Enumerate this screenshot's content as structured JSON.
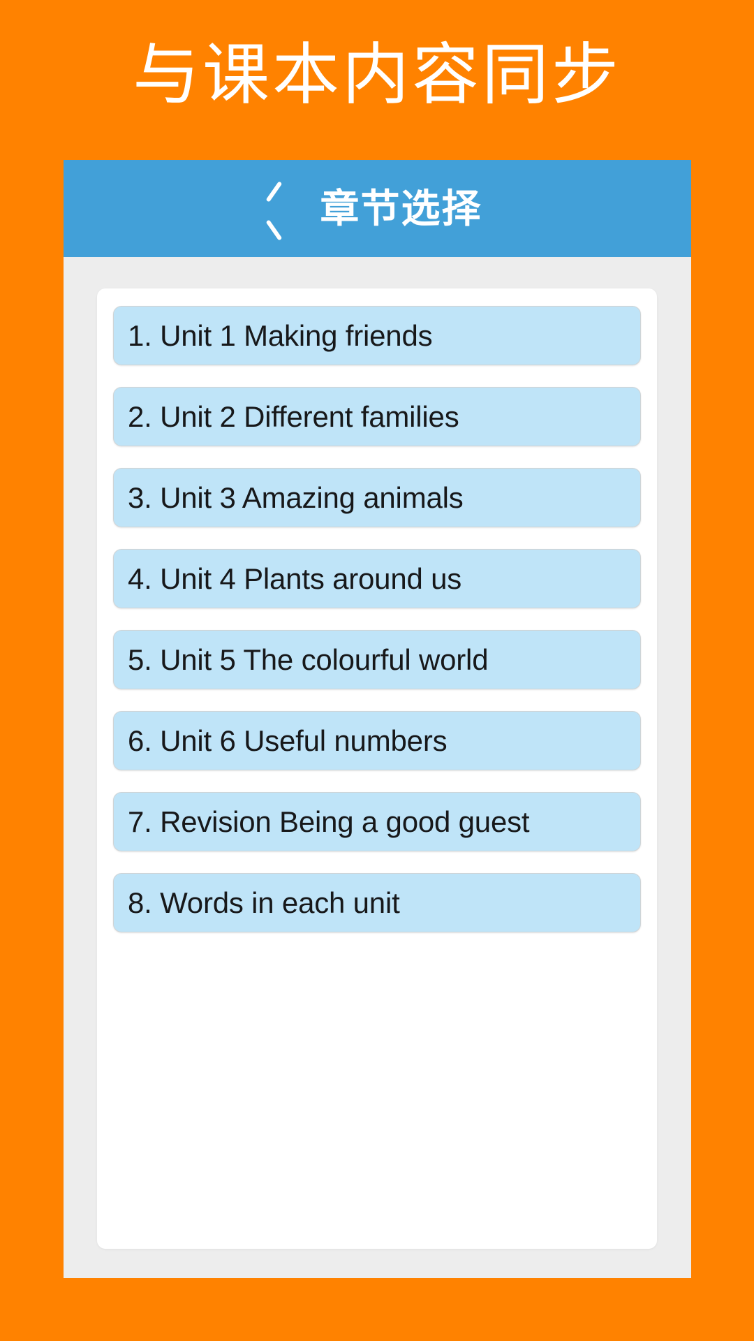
{
  "promo": {
    "headline": "与课本内容同步"
  },
  "colors": {
    "background_orange": "#FF8200",
    "nav_blue": "#42A0D8",
    "item_blue": "#BFE4F8",
    "panel_grey": "#EDEDED",
    "card_white": "#FFFFFF",
    "text_dark": "#17181A",
    "text_white": "#FFFFFF"
  },
  "nav": {
    "back_icon": "chevron-left-icon",
    "title": "章节选择"
  },
  "chapters": [
    {
      "label": "1. Unit 1 Making friends"
    },
    {
      "label": "2. Unit 2 Different families"
    },
    {
      "label": "3. Unit 3 Amazing animals"
    },
    {
      "label": "4. Unit 4 Plants around us"
    },
    {
      "label": "5. Unit 5 The colourful world"
    },
    {
      "label": "6. Unit 6 Useful numbers"
    },
    {
      "label": "7. Revision Being a good guest"
    },
    {
      "label": "8. Words in each unit"
    }
  ]
}
